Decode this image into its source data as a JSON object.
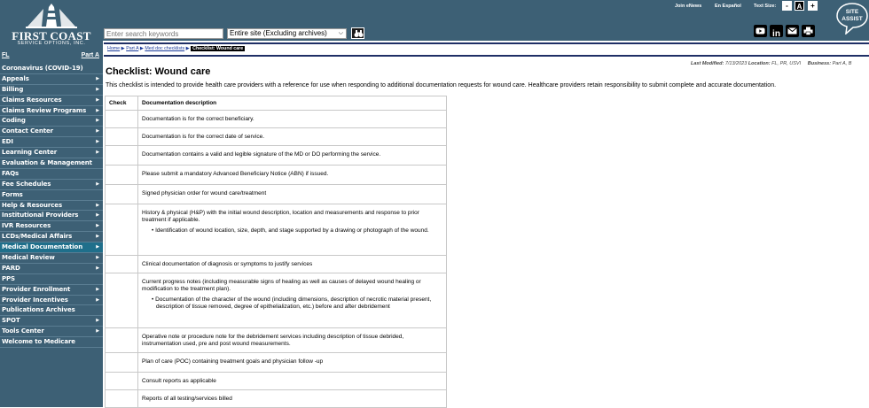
{
  "header": {
    "logo_title": "FIRST COAST",
    "logo_subtitle": "SERVICE OPTIONS, INC.",
    "search_placeholder": "Enter search keywords",
    "search_scope": "Entire site (Excluding archives)",
    "join_enews": "Join eNews",
    "en_espanol": "En Español",
    "text_size_label": "Text Size:",
    "text_size_minus": "-",
    "text_size_a": "A",
    "text_size_plus": "+",
    "site_assist_line1": "SITE",
    "site_assist_line2": "ASSIST",
    "social_linkedin": "in"
  },
  "sidebar": {
    "state": "FL",
    "part": "Part A",
    "items": [
      {
        "label": "Coronavirus (COVID-19)",
        "arrow": ""
      },
      {
        "label": "Appeals",
        "arrow": "▶"
      },
      {
        "label": "Billing",
        "arrow": "▶"
      },
      {
        "label": "Claims Resources",
        "arrow": "▶"
      },
      {
        "label": "Claims Review Programs",
        "arrow": "▶"
      },
      {
        "label": "Coding",
        "arrow": "▶"
      },
      {
        "label": "Contact Center",
        "arrow": "▶"
      },
      {
        "label": "EDI",
        "arrow": "▶"
      },
      {
        "label": "Learning Center",
        "arrow": "▶"
      },
      {
        "label": "Evaluation & Management",
        "arrow": ""
      },
      {
        "label": "FAQs",
        "arrow": ""
      },
      {
        "label": "Fee Schedules",
        "arrow": "▶"
      },
      {
        "label": "Forms",
        "arrow": ""
      },
      {
        "label": "Help & Resources",
        "arrow": "▶"
      },
      {
        "label": "Institutional Providers",
        "arrow": "▶"
      },
      {
        "label": "IVR Resources",
        "arrow": "▶"
      },
      {
        "label": "LCDs/Medical Affairs",
        "arrow": "▶"
      },
      {
        "label": "Medical Documentation",
        "arrow": "▶"
      },
      {
        "label": "Medical Review",
        "arrow": "▶"
      },
      {
        "label": "PARD",
        "arrow": "▶"
      },
      {
        "label": "PPS",
        "arrow": ""
      },
      {
        "label": "Provider Enrollment",
        "arrow": "▶"
      },
      {
        "label": "Provider Incentives",
        "arrow": "▶"
      },
      {
        "label": "Publications Archives",
        "arrow": ""
      },
      {
        "label": "SPOT",
        "arrow": "▶"
      },
      {
        "label": "Tools Center",
        "arrow": "▶"
      },
      {
        "label": "Welcome to Medicare",
        "arrow": ""
      }
    ],
    "active_index": 17
  },
  "breadcrumb": {
    "home": "Home",
    "part_a": "Part A",
    "med_doc": "Med doc checklists",
    "current": "Checklist: Wound care",
    "sep": "▶"
  },
  "meta": {
    "last_modified_label": "Last Modified:",
    "last_modified_value": "7/13/2023",
    "location_label": "Location:",
    "location_value": "FL, PR, USVI",
    "business_label": "Business:",
    "business_value": "Part A, B"
  },
  "page": {
    "title": "Checklist: Wound care",
    "intro": "This checklist is intended to provide health care providers with a reference for use when responding to additional documentation requests for wound care. Healthcare providers retain responsibility to submit complete and accurate documentation."
  },
  "table": {
    "col_check": "Check",
    "col_desc": "Documentation description",
    "rows": [
      {
        "text": "Documentation is for the correct beneficiary.",
        "bullet": ""
      },
      {
        "text": "Documentation is for the correct date of service.",
        "bullet": ""
      },
      {
        "text": "Documentation contains a valid and legible signature of the MD or DO performing the service.",
        "bullet": ""
      },
      {
        "text": "Please submit a mandatory Advanced Beneficiary Notice (ABN) if issued.",
        "bullet": ""
      },
      {
        "text": "Signed physician order for wound care/treatment",
        "bullet": ""
      },
      {
        "text": "History & physical (H&P) with the initial wound description, location and measurements and response to prior treatment if applicable.",
        "bullet": "• Identification of wound location, size, depth, and stage supported by a drawing or photograph of the wound."
      },
      {
        "text": "Clinical documentation of diagnosis or symptoms to justify services",
        "bullet": ""
      },
      {
        "text": "Current progress notes (including measurable signs of healing as well as causes of delayed wound healing or modification to the treatment plan).",
        "bullet": "• Documentation of the character of the wound (including dimensions, description of necrotic material present, description of tissue removed, degree of epithelialization, etc.) before and after debridement"
      },
      {
        "text": "Operative note or procedure note for the debridement services including description of tissue debrided, instrumentation used, pre and post wound measurements.",
        "bullet": ""
      },
      {
        "text": "Plan of care (POC) containing treatment goals and physician follow -up",
        "bullet": ""
      },
      {
        "text": "Consult reports as applicable",
        "bullet": ""
      },
      {
        "text": "Reports of all testing/services billed",
        "bullet": ""
      }
    ]
  },
  "colors": {
    "header_bg": "#3d6075",
    "nav_active": "#1f6f8b",
    "rule": "#1f2f66",
    "link": "#1a3a9a"
  }
}
